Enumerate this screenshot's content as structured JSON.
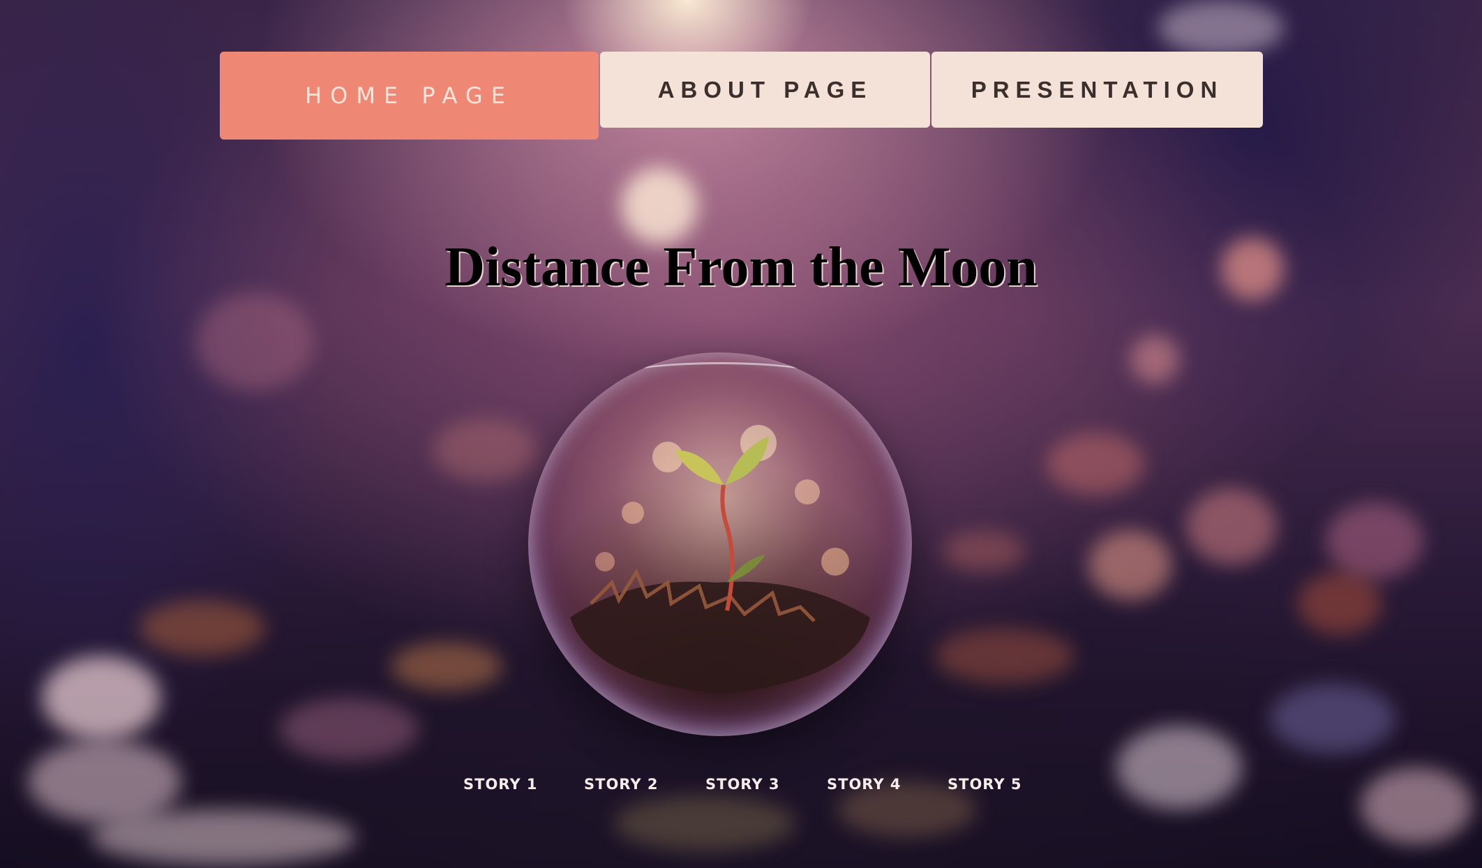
{
  "nav": {
    "home_label": "HOME PAGE",
    "about_label": "ABOUT PAGE",
    "presentation_label": "PRESENTATION"
  },
  "hero": {
    "title": "Distance From the Moon",
    "image_icon": "glass-orb-sprout-image"
  },
  "stories": [
    {
      "label": "STORY 1"
    },
    {
      "label": "STORY 2"
    },
    {
      "label": "STORY 3"
    },
    {
      "label": "STORY 4"
    },
    {
      "label": "STORY 5"
    }
  ],
  "colors": {
    "home_button_bg": "#ee8773",
    "nav_button_bg": "#f4e1d7",
    "nav_text": "#3a2f2c",
    "title_text": "#000000"
  }
}
